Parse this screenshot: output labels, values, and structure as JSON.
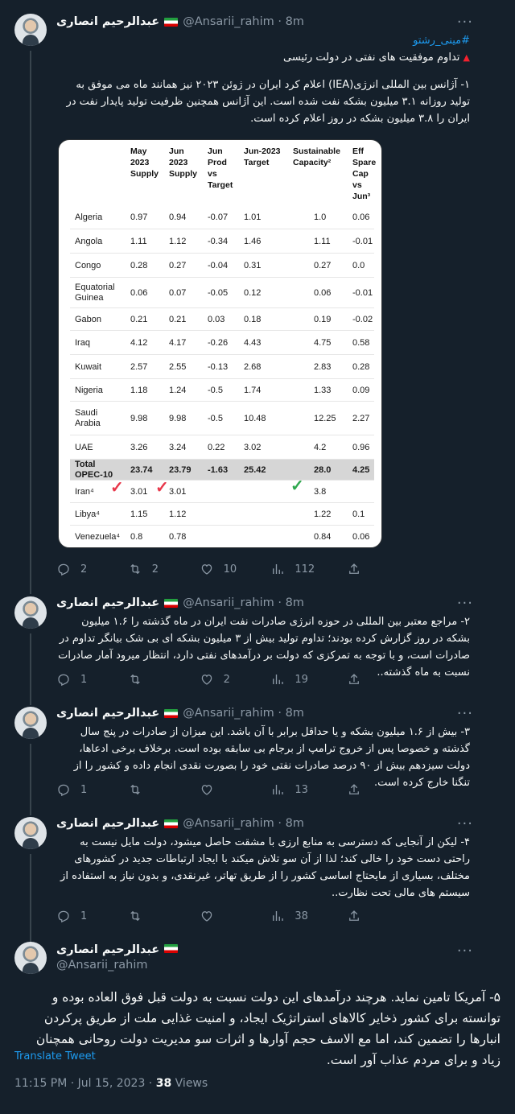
{
  "author": {
    "name": "عبدالرحیم انصاری",
    "handle": "@Ansarii_rahim",
    "flag_icon": "iran-flag-icon"
  },
  "tweets": [
    {
      "time": "8m",
      "hashtag": "#مینی_رشتو",
      "title": "تداوم موفقیت های نفتی در دولت رئیسی",
      "body": "۱- آژانس بین المللی انرژی(IEA) اعلام کرد ایران در ژوئن ۲۰۲۳ نیز همانند ماه می موفق به تولید روزانه ۳.۱ میلیون بشکه نفت شده است. این آژانس همچنین ظرفیت تولید پایدار نفت در ایران را ۳.۸ میلیون بشکه در روز اعلام کرده است.",
      "replies": "2",
      "retweets": "2",
      "likes": "10",
      "views": "112"
    },
    {
      "time": "8m",
      "body": "۲- مراجع معتبر بین المللی در حوزه انرژی صادرات نفت ایران در ماه گذشته را ۱.۶ میلیون بشکه در روز گزارش کرده بودند؛ تداوم تولید بیش از ۳ میلیون بشکه ای بی شک بیانگر تداوم در صادرات است، و با توجه به تمرکزی که دولت بر درآمدهای نفتی دارد، انتظار میرود آمار صادرات نسبت به ماه گذشته..",
      "replies": "1",
      "retweets": "",
      "likes": "2",
      "views": "19"
    },
    {
      "time": "8m",
      "body": "۳- بیش از ۱.۶ میلیون بشکه و یا حداقل برابر با آن باشد. این میزان از صادرات در پنج سال گذشته و خصوصا پس از خروج ترامپ از برجام بی سابقه بوده است. برخلاف برخی ادعاها، دولت سیزدهم بیش از ۹۰ درصد صادرات نفتی خود را بصورت نقدی انجام داده و کشور را از تنگنا خارج کرده است.",
      "replies": "1",
      "retweets": "",
      "likes": "",
      "views": "13"
    },
    {
      "time": "8m",
      "body": "۴- لیکن از آنجایی که دسترسی به منابع ارزی با مشقت حاصل میشود، دولت مایل نیست به راحتی دست خود را خالی کند؛ لذا از آن سو تلاش میکند با ایجاد ارتباطات جدید در کشورهای مختلف، بسیاری از مایحتاج اساسی کشور را از طریق تهاتر، غیرنقدی، و بدون نیاز به استفاده از سیستم های مالی تحت نظارت..",
      "replies": "1",
      "retweets": "",
      "likes": "",
      "views": "38"
    }
  ],
  "detail": {
    "body": "۵- آمریکا تامین نماید. هرچند درآمدهای این دولت نسبت به دولت قبل فوق العاده بوده و توانسته برای کشور ذخایر کالاهای استراتژیک ایجاد، و امنیت غذایی ملت از طریق پرکردن انبارها را تضمین کند، اما مع الاسف حجم آوارها و اثرات سو مدیریت دولت روحانی همچنان زیاد و برای مردم عذاب آور است.",
    "translate": "Translate Tweet",
    "time": "11:15 PM · Jul 15, 2023 · ",
    "views_count": "38",
    "views_label": " Views"
  },
  "table": {
    "headers": [
      "May\n2023\nSupply",
      "Jun\n2023\nSupply",
      "Jun\nProd\nvs\nTarget",
      "Jun-2023\nTarget",
      "Sustainable\nCapacity²",
      "Eff\nSpare\nCap\nvs\nJun³"
    ],
    "rows": [
      {
        "country": "Algeria",
        "v": [
          "0.97",
          "0.94",
          "-0.07",
          "1.01",
          "1.0",
          "0.06"
        ]
      },
      {
        "country": "Angola",
        "v": [
          "1.11",
          "1.12",
          "-0.34",
          "1.46",
          "1.11",
          "-0.01"
        ]
      },
      {
        "country": "Congo",
        "v": [
          "0.28",
          "0.27",
          "-0.04",
          "0.31",
          "0.27",
          "0.0"
        ]
      },
      {
        "country": "Equatorial\nGuinea",
        "v": [
          "0.06",
          "0.07",
          "-0.05",
          "0.12",
          "0.06",
          "-0.01"
        ]
      },
      {
        "country": "Gabon",
        "v": [
          "0.21",
          "0.21",
          "0.03",
          "0.18",
          "0.19",
          "-0.02"
        ]
      },
      {
        "country": "Iraq",
        "v": [
          "4.12",
          "4.17",
          "-0.26",
          "4.43",
          "4.75",
          "0.58"
        ]
      },
      {
        "country": "Kuwait",
        "v": [
          "2.57",
          "2.55",
          "-0.13",
          "2.68",
          "2.83",
          "0.28"
        ]
      },
      {
        "country": "Nigeria",
        "v": [
          "1.18",
          "1.24",
          "-0.5",
          "1.74",
          "1.33",
          "0.09"
        ]
      },
      {
        "country": "Saudi\nArabia",
        "v": [
          "9.98",
          "9.98",
          "-0.5",
          "10.48",
          "12.25",
          "2.27"
        ]
      },
      {
        "country": "UAE",
        "v": [
          "3.26",
          "3.24",
          "0.22",
          "3.02",
          "4.2",
          "0.96"
        ]
      },
      {
        "country": "Total\nOPEC-10",
        "v": [
          "23.74",
          "23.79",
          "-1.63",
          "25.42",
          "28.0",
          "4.25"
        ],
        "total": true
      },
      {
        "country": "Iran⁴",
        "v": [
          "3.01",
          "3.01",
          "",
          "",
          "3.8",
          ""
        ]
      },
      {
        "country": "Libya⁴",
        "v": [
          "1.15",
          "1.12",
          "",
          "",
          "1.22",
          "0.1"
        ]
      },
      {
        "country": "Venezuela⁴",
        "v": [
          "0.8",
          "0.78",
          "",
          "",
          "0.84",
          "0.06"
        ]
      }
    ]
  },
  "colors": {
    "background": "#15202b",
    "accent": "#1d9bf0",
    "check_red": "#e8374a",
    "check_green": "#2fa84f"
  }
}
